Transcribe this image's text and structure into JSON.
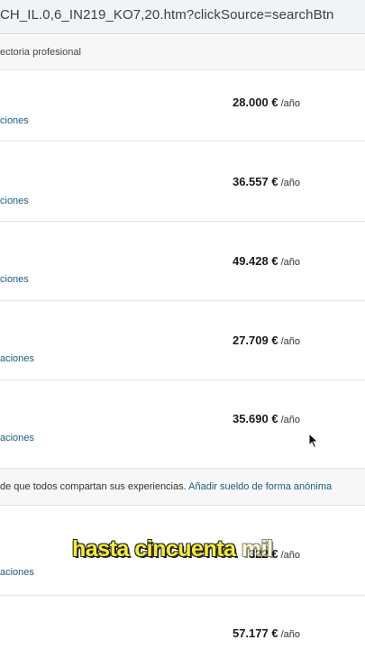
{
  "browser": {
    "url": "CH_IL.0,6_IN219_KO7,20.htm?clickSource=searchBtn"
  },
  "filter": {
    "label": "ectoria profesional"
  },
  "rows": [
    {
      "salary": "28.000 €",
      "unit": "/año",
      "link": "ciones"
    },
    {
      "salary": "36.557 €",
      "unit": "/año",
      "link": "ciones"
    },
    {
      "salary": "49.428 €",
      "unit": "/año",
      "link": "ciones"
    },
    {
      "salary": "27.709 €",
      "unit": "/año",
      "link": "aciones"
    },
    {
      "salary": "35.690 €",
      "unit": "/año",
      "link": "aciones"
    }
  ],
  "notice": {
    "text": "de que todos compartan sus experiencias. ",
    "link": "Añadir sueldo de forma anónima"
  },
  "rows_after": [
    {
      "salary": "322 €",
      "unit": "/año",
      "link": "aciones"
    },
    {
      "salary": "57.177 €",
      "unit": "/año",
      "link": ""
    }
  ],
  "caption": {
    "main": "hasta cincuenta",
    "faded": " mil"
  }
}
